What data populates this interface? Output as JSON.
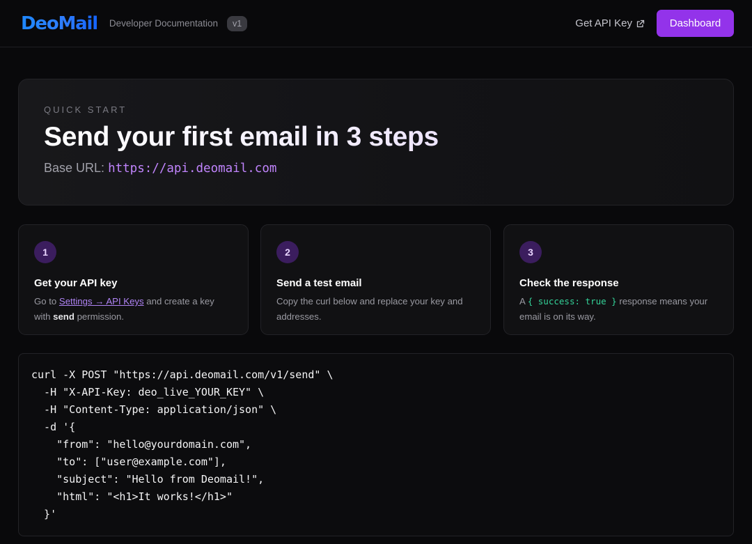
{
  "header": {
    "logo": "DeoMail",
    "subtitle": "Developer Documentation",
    "version": "v1",
    "api_key_link": "Get API Key",
    "dashboard_button": "Dashboard"
  },
  "hero": {
    "eyebrow": "QUICK START",
    "title": "Send your first email in 3 steps",
    "base_url_label": "Base URL:",
    "base_url": "https://api.deomail.com"
  },
  "steps": [
    {
      "number": "1",
      "title": "Get your API key",
      "desc_pre": "Go to ",
      "desc_link": "Settings → API Keys",
      "desc_mid": " and create a key with ",
      "desc_bold": "send",
      "desc_post": " permission."
    },
    {
      "number": "2",
      "title": "Send a test email",
      "desc": "Copy the curl below and replace your key and addresses."
    },
    {
      "number": "3",
      "title": "Check the response",
      "desc_pre": "A ",
      "desc_code": "{ success: true }",
      "desc_post": " response means your email is on its way."
    }
  ],
  "code": {
    "lines": [
      "curl -X POST \"https://api.deomail.com/v1/send\" \\",
      "  -H \"X-API-Key: deo_live_YOUR_KEY\" \\",
      "  -H \"Content-Type: application/json\" \\",
      "  -d '{",
      "    \"from\": \"hello@yourdomain.com\",",
      "    \"to\": [\"user@example.com\"],",
      "    \"subject\": \"Hello from Deomail!\",",
      "    \"html\": \"<h1>It works!</h1>\"",
      "  }'"
    ]
  },
  "colors": {
    "accent": "#9333ea",
    "logo_blue": "#1e88ff",
    "link_purple": "#c084fc",
    "code_green": "#34d399"
  },
  "icons": {
    "external_link": "external-link-icon"
  }
}
